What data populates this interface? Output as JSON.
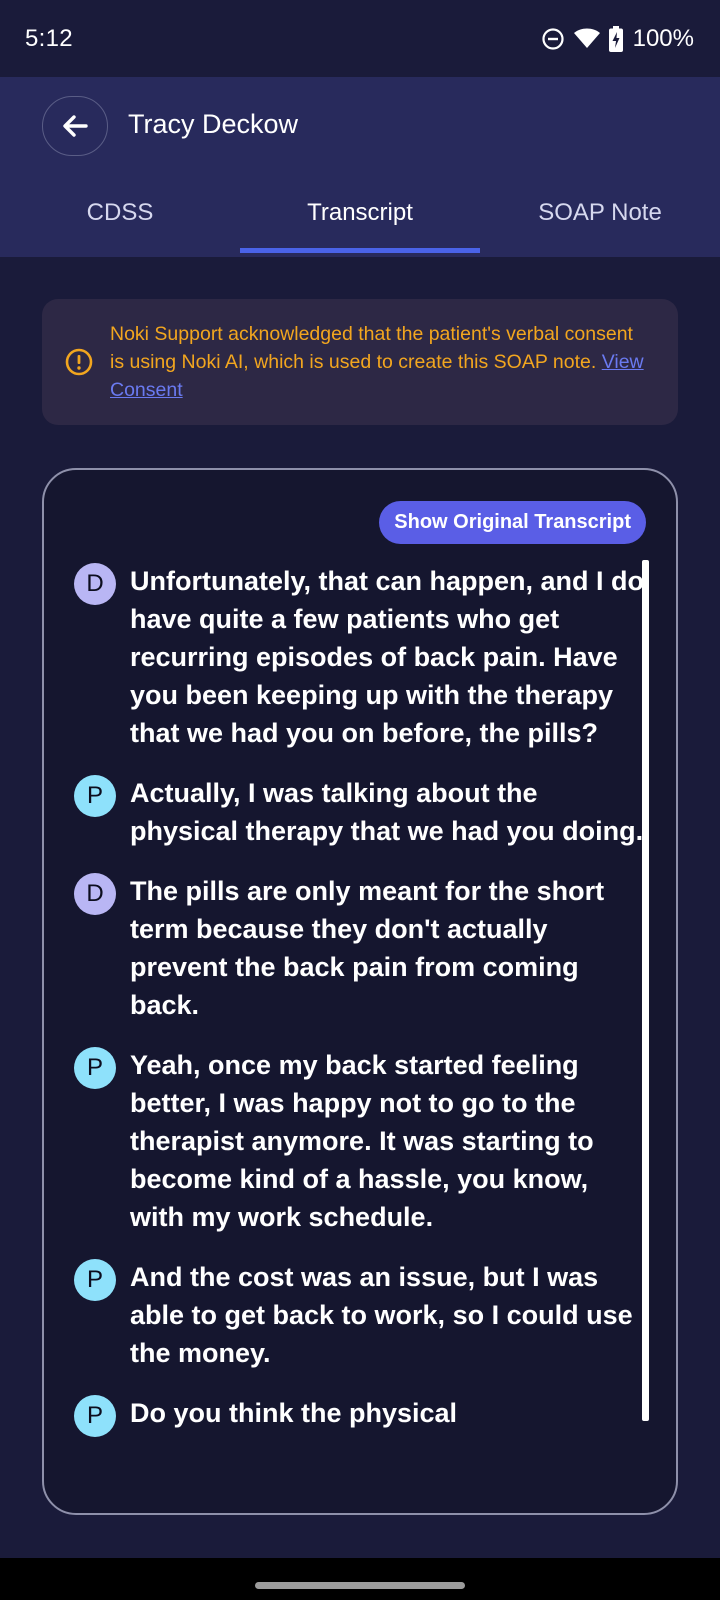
{
  "status_bar": {
    "time": "5:12",
    "battery": "100%",
    "icons": [
      "do-not-disturb-icon",
      "wifi-icon",
      "battery-charging-icon"
    ]
  },
  "header": {
    "title": "Tracy Deckow",
    "back_icon": "arrow-left-icon"
  },
  "tabs": [
    {
      "label": "CDSS",
      "active": false
    },
    {
      "label": "Transcript",
      "active": true
    },
    {
      "label": "SOAP Note",
      "active": false
    }
  ],
  "consent": {
    "icon": "info-icon",
    "text": "Noki Support acknowledged that the patient's verbal consent is using Noki AI, which is used to create this SOAP note. ",
    "link": "View Consent"
  },
  "transcript": {
    "show_original_label": "Show Original Transcript",
    "messages": [
      {
        "speaker": "D",
        "role": "doctor",
        "text": "Unfortunately, that can happen, and I do have quite a few patients who get recurring episodes of back pain. Have you been keeping up with the therapy that we had you on before, the pills?"
      },
      {
        "speaker": "P",
        "role": "patient",
        "text": "Actually, I was talking about the physical therapy that we had you doing."
      },
      {
        "speaker": "D",
        "role": "doctor",
        "text": "The pills are only meant for the short term because they don't actually prevent the back pain from coming back."
      },
      {
        "speaker": "P",
        "role": "patient",
        "text": "Yeah, once my back started feeling better, I was happy not to go to the therapist anymore. It was starting to become kind of a hassle, you know, with my work schedule."
      },
      {
        "speaker": "P",
        "role": "patient",
        "text": "And the cost was an issue, but I was able to get back to work, so I could use the money."
      },
      {
        "speaker": "P",
        "role": "patient",
        "text": "Do you think the physical"
      }
    ]
  },
  "colors": {
    "background": "#1a1b3a",
    "header": "#282a5c",
    "accent": "#4a63e8",
    "warning": "#f2a61f",
    "button": "#5a5ee6",
    "doctor_avatar": "#b9b6f4",
    "patient_avatar": "#8ee1fb"
  }
}
